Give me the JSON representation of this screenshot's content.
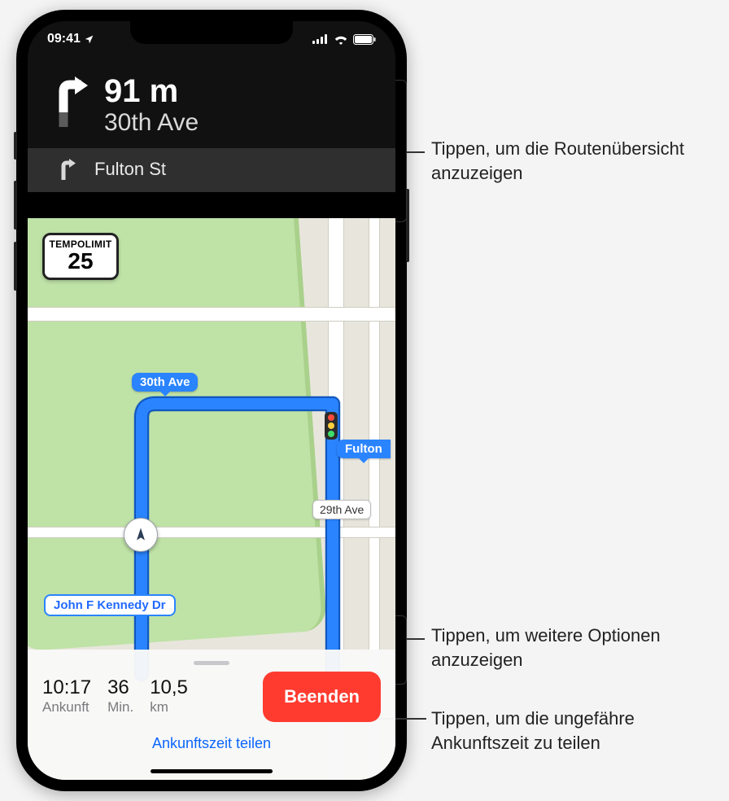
{
  "status": {
    "time": "09:41"
  },
  "nav": {
    "distance": "91 m",
    "street": "30th Ave",
    "next_street": "Fulton St"
  },
  "speed_limit": {
    "title": "TEMPOLIMIT",
    "value": "25"
  },
  "map_labels": {
    "route_label": "30th Ave",
    "fulton": "Fulton",
    "ave29": "29th Ave",
    "current_road": "John F Kennedy Dr"
  },
  "bottom": {
    "arrival_value": "10:17",
    "arrival_label": "Ankunft",
    "minutes_value": "36",
    "minutes_label": "Min.",
    "dist_value": "10,5",
    "dist_label": "km",
    "end_label": "Beenden",
    "share_label": "Ankunftszeit teilen"
  },
  "callouts": {
    "overview": "Tippen, um die Routenübersicht anzuzeigen",
    "options": "Tippen, um weitere Optionen anzuzeigen",
    "share": "Tippen, um die ungefähre Ankunftszeit zu teilen"
  }
}
